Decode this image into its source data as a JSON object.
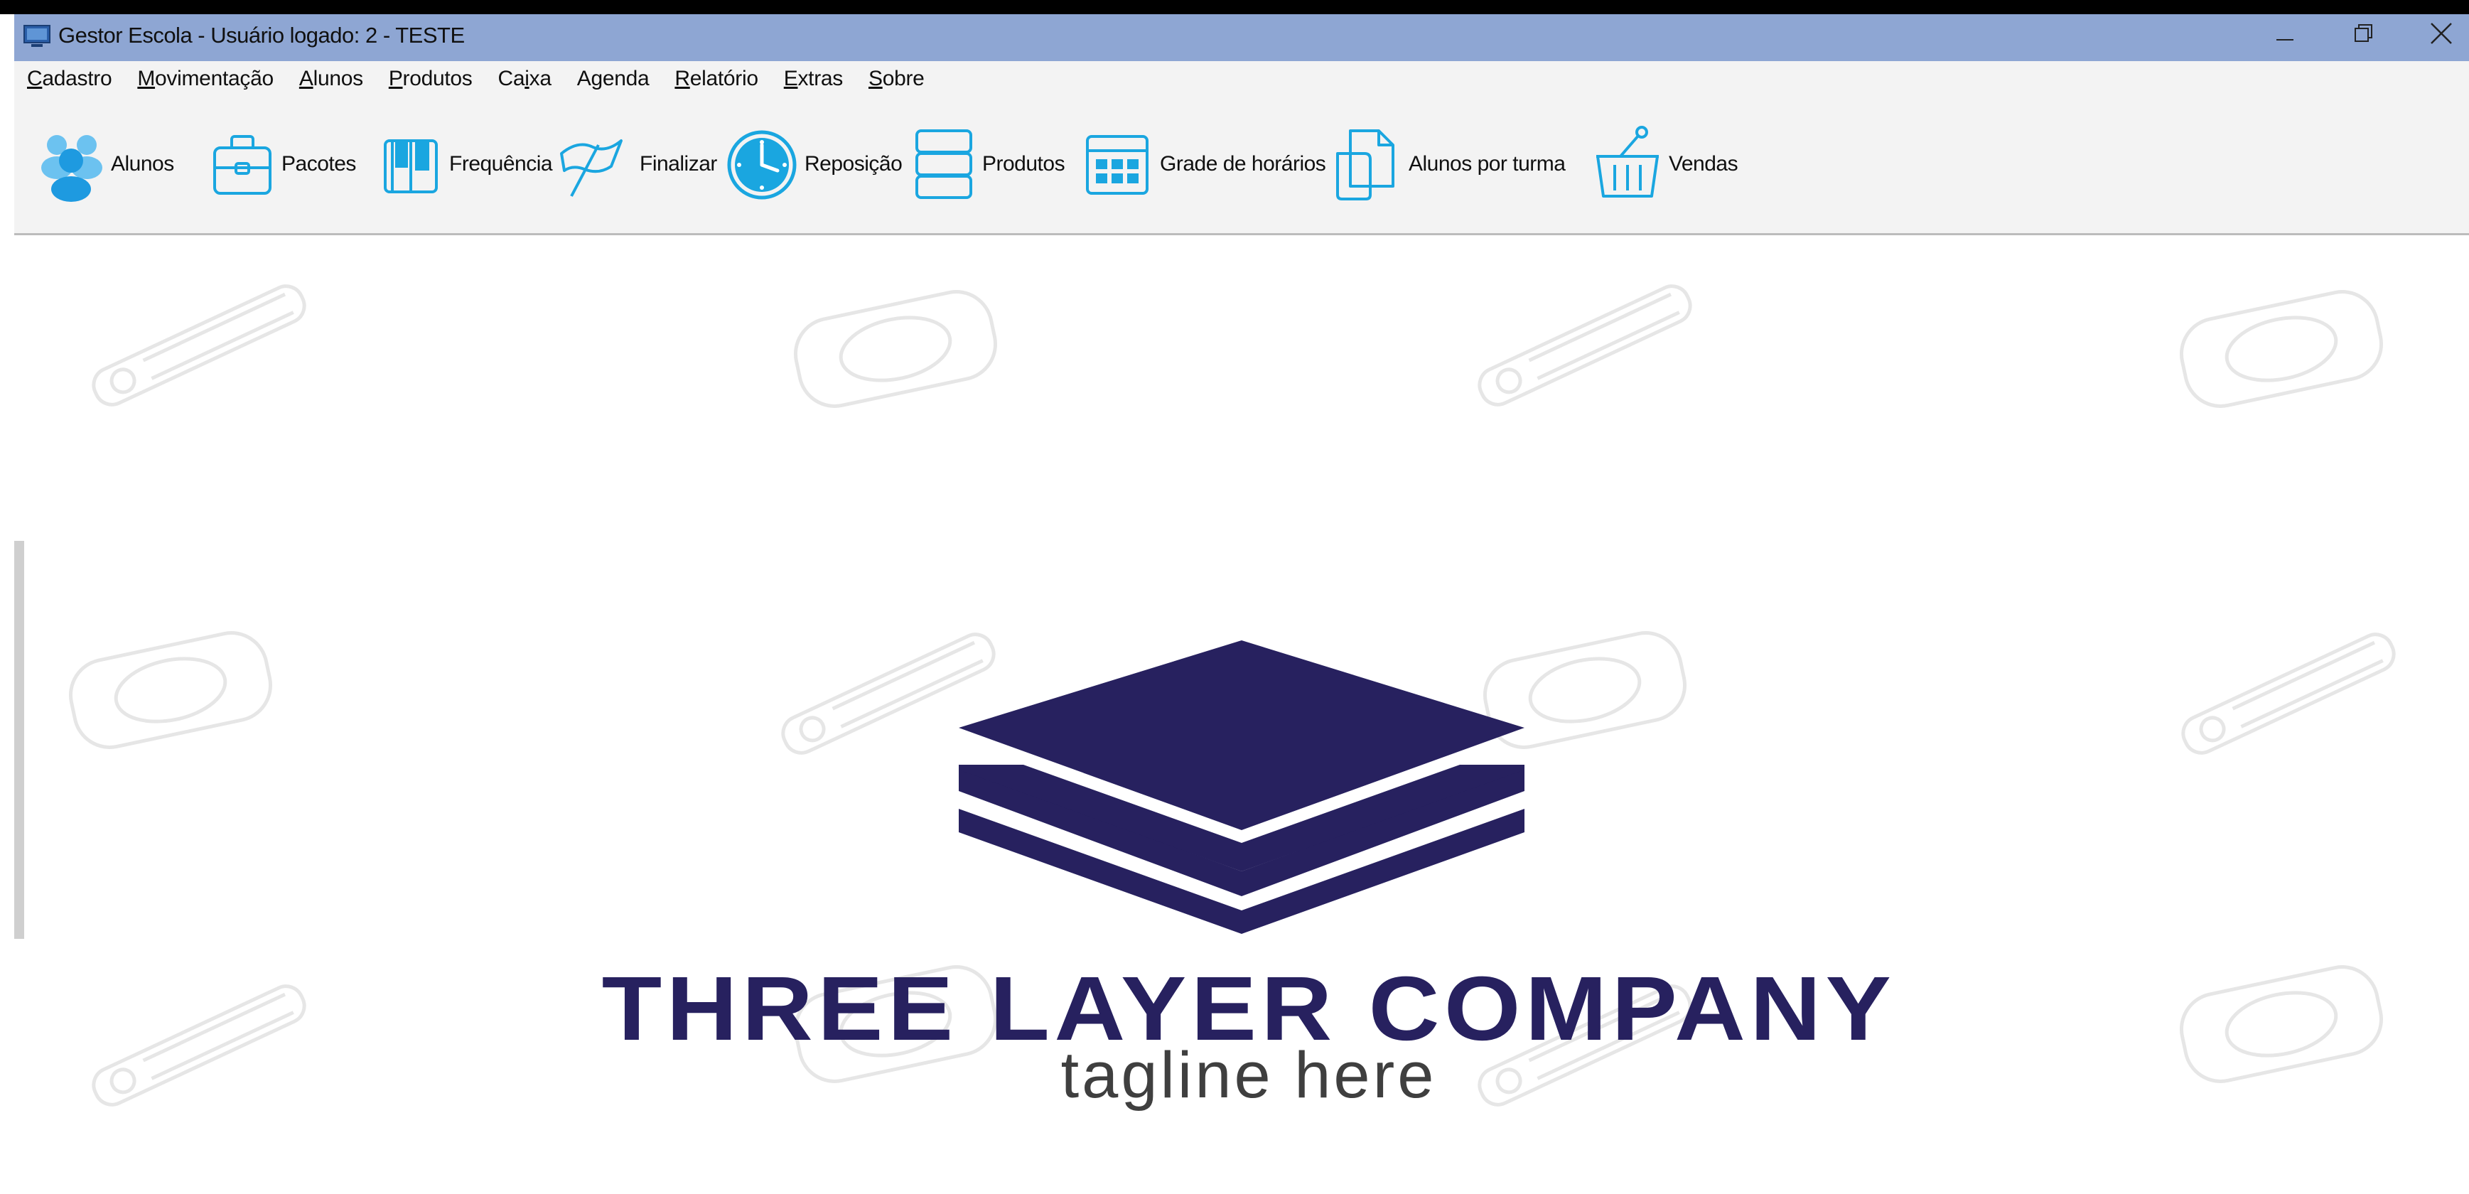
{
  "window": {
    "title": "Gestor Escola - Usuário logado: 2 - TESTE",
    "controls": [
      "minimize",
      "restore",
      "close"
    ]
  },
  "menu": [
    {
      "label": "Cadastro",
      "mnemonic": "C"
    },
    {
      "label": "Movimentação",
      "mnemonic": "M"
    },
    {
      "label": "Alunos",
      "mnemonic": "A"
    },
    {
      "label": "Produtos",
      "mnemonic": "P"
    },
    {
      "label": "Caixa",
      "mnemonic": "i"
    },
    {
      "label": "Agenda",
      "mnemonic": "g"
    },
    {
      "label": "Relatório",
      "mnemonic": "R"
    },
    {
      "label": "Extras",
      "mnemonic": "E"
    },
    {
      "label": "Sobre",
      "mnemonic": "S"
    }
  ],
  "toolbar": [
    {
      "label": "Alunos",
      "icon": "users-icon"
    },
    {
      "label": "Pacotes",
      "icon": "briefcase-icon"
    },
    {
      "label": "Frequência",
      "icon": "book-icon"
    },
    {
      "label": "Finalizar",
      "icon": "flag-icon"
    },
    {
      "label": "Reposição",
      "icon": "clock-icon"
    },
    {
      "label": "Produtos",
      "icon": "boxes-icon"
    },
    {
      "label": "Grade de horários",
      "icon": "grid-calendar-icon"
    },
    {
      "label": "Alunos por turma",
      "icon": "document-icon"
    },
    {
      "label": "Vendas",
      "icon": "basket-icon"
    }
  ],
  "logo": {
    "company": "THREE LAYER COMPANY",
    "tagline": "tagline here",
    "color": "#27215f",
    "tagline_color": "#3f3f3f"
  },
  "colors": {
    "titlebar": "#8ea6d3",
    "toolbar_bg": "#f3f3f3",
    "icon_blue": "#1aa6e0"
  }
}
